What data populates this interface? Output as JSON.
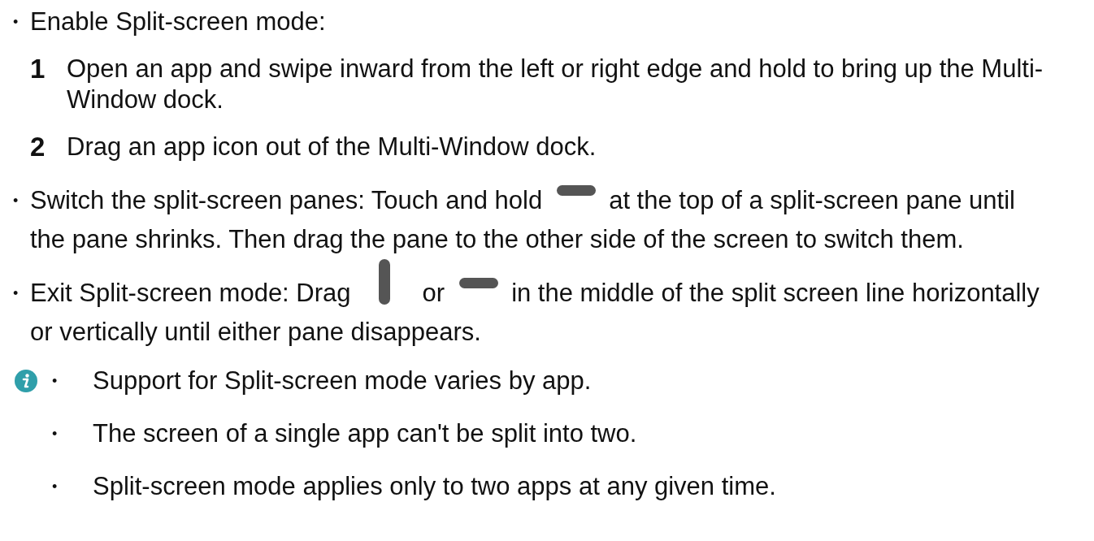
{
  "items": [
    {
      "marker": "•",
      "lines": [
        [
          {
            "kind": "text",
            "text": "Enable Split-screen mode:"
          }
        ]
      ],
      "steps": [
        {
          "number": "1",
          "text": "Open an app and swipe inward from the left or right edge and hold to bring up the Multi-Window dock."
        },
        {
          "number": "2",
          "text": "Drag an app icon out of the Multi-Window dock."
        }
      ]
    },
    {
      "marker": "•",
      "lines": [
        [
          {
            "kind": "text",
            "text": "Switch the split-screen panes: Touch and hold"
          },
          {
            "kind": "hbar"
          },
          {
            "kind": "text",
            "text": "at the top of a split-screen pane until"
          }
        ],
        [
          {
            "kind": "text",
            "text": "the pane shrinks. Then drag the pane to the other side of the screen to switch them."
          }
        ]
      ]
    },
    {
      "marker": "•",
      "lines": [
        [
          {
            "kind": "text",
            "text": "Exit Split-screen mode: Drag"
          },
          {
            "kind": "vbar"
          },
          {
            "kind": "text",
            "text": "or"
          },
          {
            "kind": "hbar"
          },
          {
            "kind": "text",
            "text": "in the middle of the split screen line horizontally"
          }
        ],
        [
          {
            "kind": "text",
            "text": "or vertically until either pane disappears."
          }
        ]
      ]
    }
  ],
  "note": {
    "items": [
      {
        "marker": "•",
        "text": "Support for Split-screen mode varies by app."
      },
      {
        "marker": "•",
        "text": "The screen of a single app can't be split into two."
      },
      {
        "marker": "•",
        "text": "Split-screen mode applies only to two apps at any given time."
      }
    ]
  }
}
